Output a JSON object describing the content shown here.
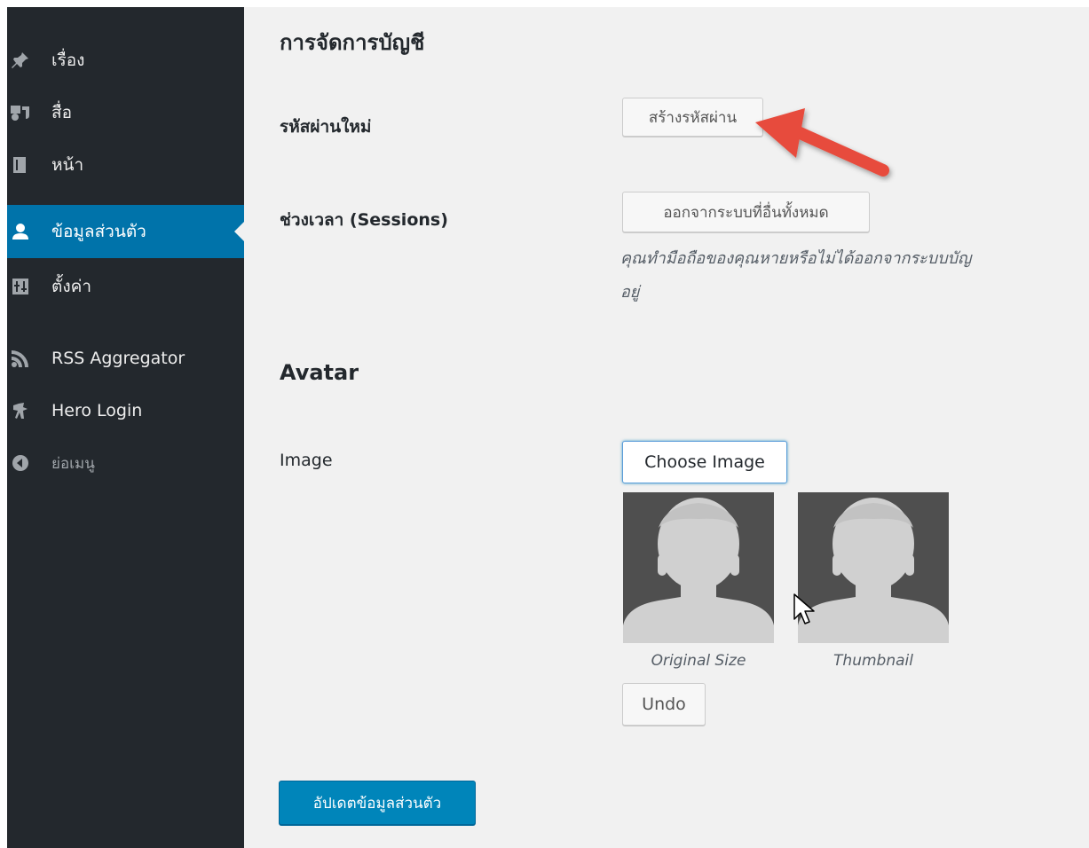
{
  "sidebar": {
    "items": [
      {
        "label": "เรื่อง",
        "icon": "pushpin-icon"
      },
      {
        "label": "สื่อ",
        "icon": "media-icon"
      },
      {
        "label": "หน้า",
        "icon": "page-icon"
      },
      {
        "label": "ข้อมูลส่วนตัว",
        "icon": "user-icon",
        "active": true
      },
      {
        "label": "ตั้งค่า",
        "icon": "settings-icon"
      },
      {
        "label": "RSS Aggregator",
        "icon": "rss-icon"
      },
      {
        "label": "Hero Login",
        "icon": "hero-login-icon"
      },
      {
        "label": "ย่อเมนู",
        "icon": "collapse-icon"
      }
    ]
  },
  "main": {
    "section_title": "การจัดการบัญชี",
    "new_password": {
      "label": "รหัสผ่านใหม่",
      "button": "สร้างรหัสผ่าน"
    },
    "sessions": {
      "label": "ช่วงเวลา (Sessions)",
      "button": "ออกจากระบบที่อื่นทั้งหมด",
      "description_line1": "คุณทำมือถือของคุณหายหรือไม่ได้ออกจากระบบบัญ",
      "description_line2": "อยู่"
    },
    "avatar": {
      "title": "Avatar",
      "image_label": "Image",
      "choose_button": "Choose Image",
      "original_caption": "Original Size",
      "thumbnail_caption": "Thumbnail",
      "undo_button": "Undo"
    },
    "submit_button": "อัปเดตข้อมูลส่วนตัว"
  },
  "colors": {
    "sidebar_bg": "#23282d",
    "active_bg": "#0073aa",
    "primary_button": "#0085ba",
    "annotation_arrow": "#e74c3c"
  }
}
